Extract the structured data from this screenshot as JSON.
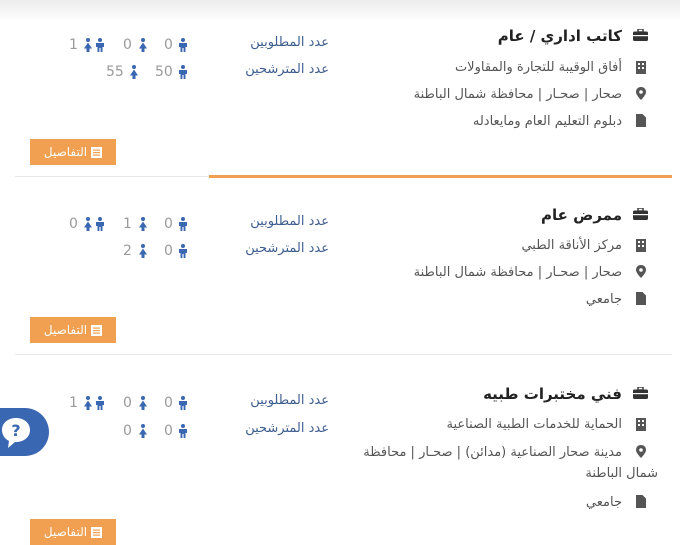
{
  "stats_labels": {
    "required": "عدد المطلوبين",
    "candidates": "عدد المترشحين"
  },
  "details_button": "التفاصيل",
  "colors": {
    "accent": "#f0a050",
    "label_blue": "#3d5d8f",
    "icon_dark": "#333333",
    "person_blue": "#3a67b1",
    "chat_blue": "#3a67b1"
  },
  "icons": {
    "title": "briefcase-icon",
    "company": "building-icon",
    "location": "map-pin-icon",
    "education": "document-icon",
    "male": "male-icon",
    "female": "female-icon",
    "couple": "couple-icon",
    "chat": "chat-help-icon"
  },
  "jobs": [
    {
      "title": "كاتب اداري / عام",
      "company": "أفاق الوقيبة للتجارة والمقاولات",
      "location": "صحار | صحـار | محافظة شمال الباطنة",
      "location_cont": "",
      "education": "دبلوم التعليم العام ومايعادله",
      "required": {
        "male": "0",
        "female": "0",
        "total": "1"
      },
      "candidates": {
        "male": "50",
        "female": "55"
      }
    },
    {
      "title": "ممرض عام",
      "company": "مركز الأناقة الطبي",
      "location": "صحار | صحـار | محافظة شمال الباطنة",
      "location_cont": "",
      "education": "جامعي",
      "required": {
        "male": "0",
        "female": "1",
        "total": "0"
      },
      "candidates": {
        "male": "0",
        "female": "2"
      }
    },
    {
      "title": "فني مختبرات طبيه",
      "company": "الحماية للخدمات الطبية الصناعية",
      "location": "مدينة صحار الصناعية (مدائن) | صحـار | محافظة",
      "location_cont": "شمال الباطنة",
      "education": "جامعي",
      "required": {
        "male": "0",
        "female": "0",
        "total": "1"
      },
      "candidates": {
        "male": "0",
        "female": "0"
      }
    }
  ]
}
